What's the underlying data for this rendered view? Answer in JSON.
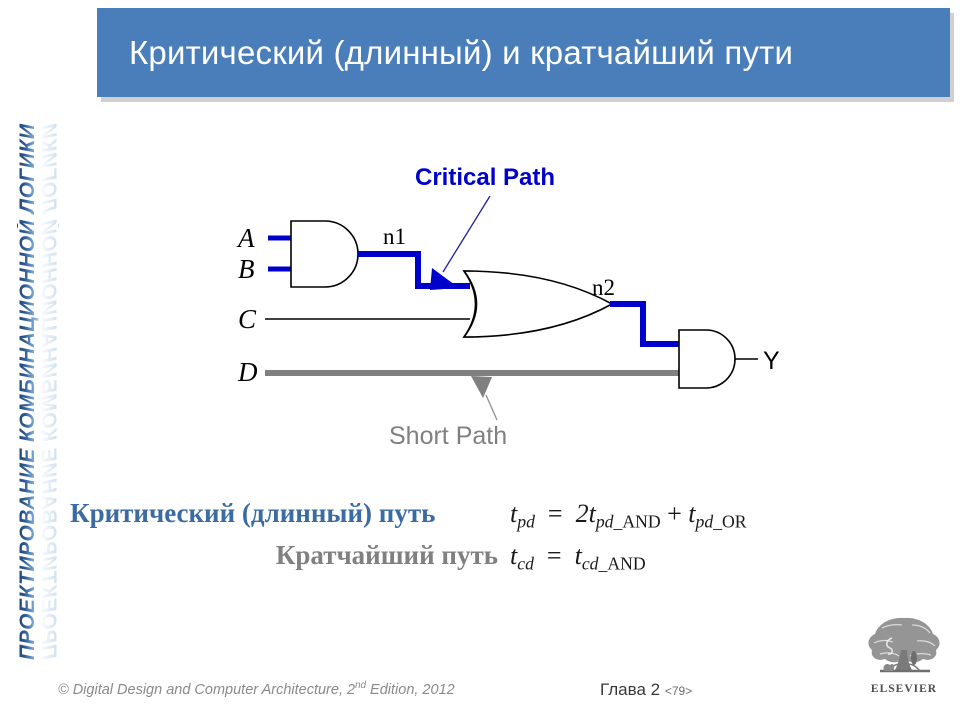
{
  "sidebar": {
    "vertical_title": "ПРОЕКТИРОВАНИЕ КОМБИНАЦИОННОЙ ЛОГИКИ"
  },
  "title_bar": {
    "title": "Критический (длинный) и кратчайший пути",
    "background_color": "#4A7EBB",
    "text_color": "#FFFFFF"
  },
  "circuit": {
    "inputs": [
      {
        "label": "A",
        "wire_style": "critical"
      },
      {
        "label": "B",
        "wire_style": "critical"
      },
      {
        "label": "C",
        "wire_style": "normal"
      },
      {
        "label": "D",
        "wire_style": "short"
      }
    ],
    "nets": [
      {
        "label": "n1"
      },
      {
        "label": "n2"
      }
    ],
    "output": {
      "label": "Y"
    },
    "gates": [
      {
        "type": "AND",
        "name": "and-gate-1"
      },
      {
        "type": "OR",
        "name": "or-gate-1"
      },
      {
        "type": "AND",
        "name": "and-gate-2"
      }
    ],
    "annotations": [
      {
        "label": "Critical Path",
        "color": "#0000CC"
      },
      {
        "label": "Short Path",
        "color": "#808080"
      }
    ],
    "colors": {
      "critical_path": "#0000CC",
      "short_path": "#808080",
      "wire": "#000000"
    }
  },
  "formulas": {
    "critical_label": "Критический (длинный) путь",
    "critical_label_color": "#3B6BA5",
    "short_label": "Кратчайший путь",
    "short_label_color": "#808080",
    "critical_equation": {
      "lhs_var": "t",
      "lhs_sub": "pd",
      "rhs": "2t",
      "rhs_sub_italic": "pd",
      "rhs_sub_upright": "_AND",
      "plus": "+",
      "term2": "t",
      "term2_sub_italic": "pd",
      "term2_sub_upright": "_OR",
      "plain": "tpd = 2tpd_AND + tpd_OR"
    },
    "short_equation": {
      "lhs_var": "t",
      "lhs_sub": "cd",
      "rhs": "t",
      "rhs_sub_italic": "cd",
      "rhs_sub_upright": "_AND",
      "plain": "tcd = tcd_AND"
    }
  },
  "footer": {
    "copyright_prefix": "© Digital Design and Computer Architecture, 2",
    "copyright_sup": "nd",
    "copyright_suffix": " Edition, 2012",
    "chapter": "Глава 2",
    "page": "<79>",
    "publisher": "ELSEVIER"
  }
}
